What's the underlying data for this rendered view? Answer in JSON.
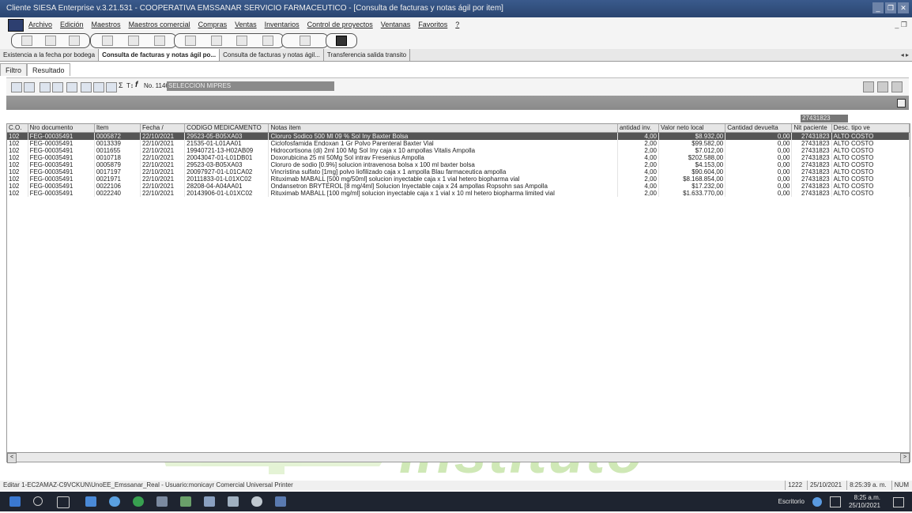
{
  "window": {
    "title": "Cliente SIESA Enterprise v.3.21.531 - COOPERATIVA EMSSANAR SERVICIO FARMACEUTICO - [Consulta de facturas y notas ágil por item]",
    "controls": [
      "_",
      "❐",
      "✕"
    ]
  },
  "menu": {
    "items": [
      "Archivo",
      "Edición",
      "Maestros",
      "Maestros comercial",
      "Compras",
      "Ventas",
      "Inventarios",
      "Control de proyectos",
      "Ventanas",
      "Favoritos",
      "?"
    ],
    "mdi_controls": "_ ❐"
  },
  "doc_tabs": [
    {
      "label": "Existencia a la fecha por bodega",
      "active": false
    },
    {
      "label": "Consulta de facturas y notas ágil po...",
      "active": true
    },
    {
      "label": "Consulta de facturas y notas ágil...",
      "active": false
    },
    {
      "label": "Transferencia salida transito",
      "active": false
    }
  ],
  "doc_tab_arrows": "◂ ▸",
  "subtabs": [
    {
      "label": "Filtro",
      "active": false
    },
    {
      "label": "Resultado",
      "active": true
    }
  ],
  "grid_toolbar": {
    "sigma_label": "Σ",
    "text_label": "T↕",
    "fx_label": "f",
    "no_label": "No. 11460",
    "selection_label": "SELECCION MIPRES"
  },
  "filter_value": "27431823",
  "table": {
    "columns": [
      "C.O.",
      "Nro documento",
      "Item",
      "Fecha /",
      "CODIGO MEDICAMENTO",
      "Notas item",
      "antidad inv.",
      "Valor neto local",
      "Cantidad devuelta",
      "Nit paciente",
      "Desc. tipo ve"
    ],
    "rows": [
      [
        "102",
        "FEG-00035491",
        "0005872",
        "22/10/2021",
        "29523-05-B05XA03",
        "Cloruro Sodico 500 Ml 09 % Sol Iny Baxter Bolsa",
        "4,00",
        "$8.932,00",
        "0,00",
        "27431823",
        "ALTO COSTO"
      ],
      [
        "102",
        "FEG-00035491",
        "0013339",
        "22/10/2021",
        "21535-01-L01AA01",
        "Ciclofosfamida Endoxan 1 Gr Polvo Parenteral Baxter Vial",
        "2,00",
        "$99.582,00",
        "0,00",
        "27431823",
        "ALTO COSTO"
      ],
      [
        "102",
        "FEG-00035491",
        "0011655",
        "22/10/2021",
        "19940721-13-H02AB09",
        "Hidrocortisona (di) 2ml 100 Mg Sol Iny caja x 10 ampollas  Vitalis Ampolla",
        "2,00",
        "$7.012,00",
        "0,00",
        "27431823",
        "ALTO COSTO"
      ],
      [
        "102",
        "FEG-00035491",
        "0010718",
        "22/10/2021",
        "20043047-01-L01DB01",
        "Doxorubicina 25 ml 50Mg Sol intrav Fresenius Ampolla",
        "4,00",
        "$202.588,00",
        "0,00",
        "27431823",
        "ALTO COSTO"
      ],
      [
        "102",
        "FEG-00035491",
        "0005879",
        "22/10/2021",
        "29523-03-B05XA03",
        "Cloruro de sodio [0.9%] solucion intravenosa bolsa x 100 ml baxter bolsa",
        "2,00",
        "$4.153,00",
        "0,00",
        "27431823",
        "ALTO COSTO"
      ],
      [
        "102",
        "FEG-00035491",
        "0017197",
        "22/10/2021",
        "20097927-01-L01CA02",
        "Vincristina sulfato [1mg] polvo liofilizado caja x 1 ampolla Blau farmaceutica ampolla",
        "4,00",
        "$90.604,00",
        "0,00",
        "27431823",
        "ALTO COSTO"
      ],
      [
        "102",
        "FEG-00035491",
        "0021971",
        "22/10/2021",
        "20111833-01-L01XC02",
        "Rituximab MABALL [500 mg/50ml] solucion inyectable caja x 1 vial hetero biopharma vial",
        "2,00",
        "$8.168.854,00",
        "0,00",
        "27431823",
        "ALTO COSTO"
      ],
      [
        "102",
        "FEG-00035491",
        "0022106",
        "22/10/2021",
        "28208-04-A04AA01",
        "Ondansetron BRYTEROL [8 mg/4ml] Solucion Inyectable caja x 24 ampollas Ropsohn sas Ampolla",
        "4,00",
        "$17.232,00",
        "0,00",
        "27431823",
        "ALTO COSTO"
      ],
      [
        "102",
        "FEG-00035491",
        "0022240",
        "22/10/2021",
        "20143906-01-L01XC02",
        "Rituximab MABALL [100 mg/ml] solucion inyectable caja x 1 vial x 10 ml hetero biopharma limited vial",
        "2,00",
        "$1.633.770,00",
        "0,00",
        "27431823",
        "ALTO COSTO"
      ]
    ]
  },
  "status": {
    "left": "Editar  1-EC2AMAZ-C9VCKUN\\UnoEE_Emssanar_Real - Usuario:monicayr  Comercial  Universal Printer",
    "cells": [
      "1222",
      "25/10/2021",
      "8:25:39 a. m.",
      "NUM"
    ]
  },
  "taskbar": {
    "desk_label": "Escritorio",
    "time": "8:25 a.m.",
    "date": "25/10/2021"
  },
  "watermark_text": "Instituto",
  "colors": {
    "title_bg": "#2f4c7c",
    "selected_row": "#555555",
    "watermark": "#cfe8b6"
  }
}
